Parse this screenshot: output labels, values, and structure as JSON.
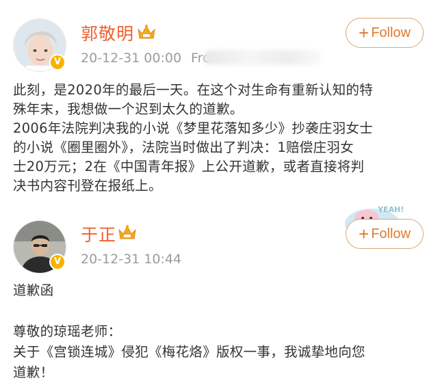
{
  "post1": {
    "username": "郭敬明",
    "timestamp": "20-12-31 00:00",
    "source_prefix": "From",
    "follow_label": "Follow",
    "lines": [
      "此刻，是2020年的最后一天。在这个对生命有重新认知的特",
      "殊年末，我想做一个迟到太久的道歉。",
      "2006年法院判决我的小说《梦里花落知多少》抄袭庄羽女士",
      "的小说《圈里圈外》，法院当时做出了判决：1赔偿庄羽女",
      "士20万元；2在《中国青年报》上公开道歉，或者直接将判",
      "决书内容刊登在报纸上。"
    ]
  },
  "post2": {
    "username": "于正",
    "timestamp": "20-12-31 10:44",
    "follow_label": "Follow",
    "sticker_text": "YEAH!",
    "lines": [
      "道歉函",
      "",
      "尊敬的琼瑶老师：",
      "关于《宫锁连城》侵犯《梅花烙》版权一事，我诚挚地向您",
      "道歉！"
    ]
  },
  "icons": {
    "verified": "verified-v-icon",
    "crown": "vip-crown-icon",
    "plus": "plus-icon"
  },
  "colors": {
    "username": "#f0602e",
    "follow_text": "#e07a2b",
    "follow_border": "#d9a672",
    "meta": "#9b9b9b",
    "badge": "#f5b300",
    "crown": "#f5a623"
  }
}
